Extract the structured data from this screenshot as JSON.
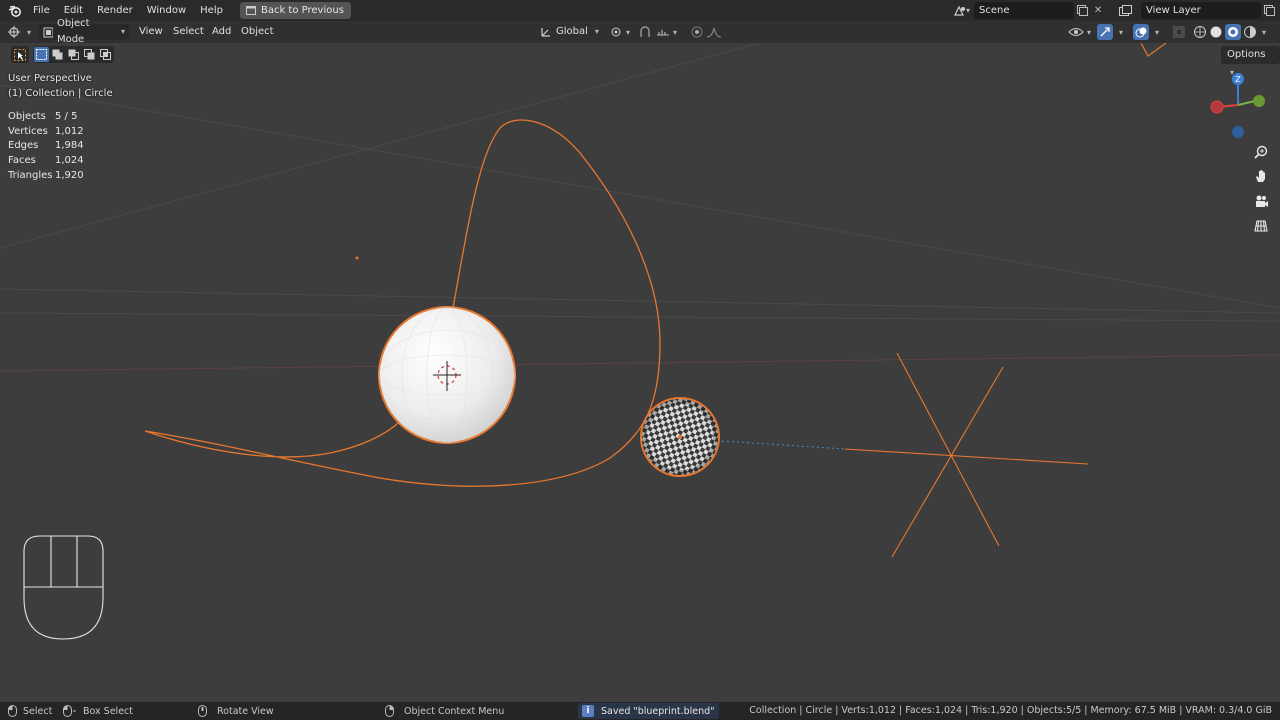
{
  "menu": {
    "file": "File",
    "edit": "Edit",
    "render": "Render",
    "window": "Window",
    "help": "Help",
    "back": "Back to Previous"
  },
  "scene": {
    "name": "Scene",
    "view_layer": "View Layer"
  },
  "header": {
    "mode": "Object Mode",
    "view": "View",
    "select": "Select",
    "add": "Add",
    "object": "Object",
    "transform": "Global",
    "options": "Options"
  },
  "overlay": {
    "perspective": "User Perspective",
    "collection": "(1) Collection | Circle"
  },
  "stats": [
    {
      "k": "Objects",
      "v": "5 / 5"
    },
    {
      "k": "Vertices",
      "v": "1,012"
    },
    {
      "k": "Edges",
      "v": "1,984"
    },
    {
      "k": "Faces",
      "v": "1,024"
    },
    {
      "k": "Triangles",
      "v": "1,920"
    }
  ],
  "gizmo": {
    "z": "Z"
  },
  "status": {
    "select": "Select",
    "box_select": "Box Select",
    "rotate": "Rotate View",
    "context": "Object Context Menu",
    "saved": "Saved \"blueprint.blend\"",
    "info": "Collection | Circle | Verts:1,012 | Faces:1,024 | Tris:1,920 | Objects:5/5 | Memory: 67.5 MiB | VRAM: 0.3/4.0 GiB"
  },
  "colors": {
    "accent_orange": "#e8772e",
    "selection": "#f08a2a",
    "axis_x": "#e0423f",
    "axis_y": "#7cb342",
    "axis_z": "#3b82d6"
  }
}
